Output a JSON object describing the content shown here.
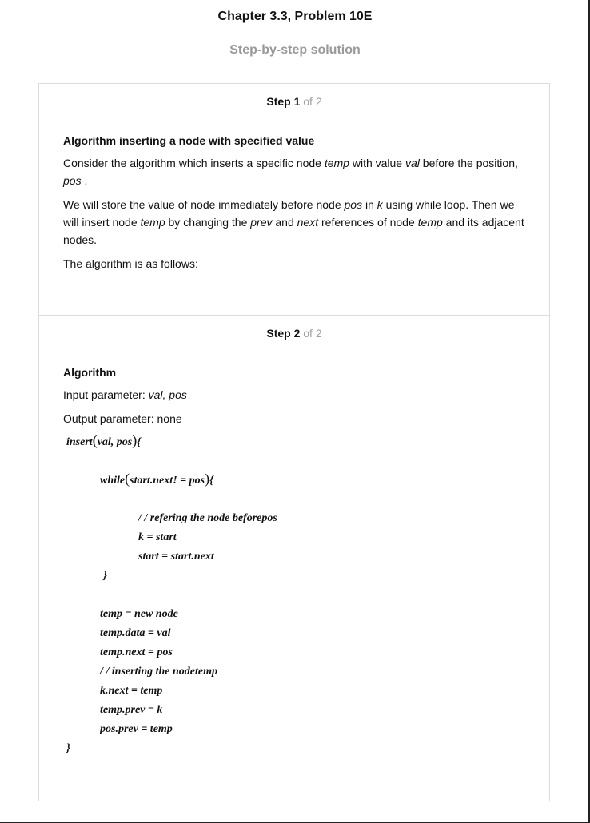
{
  "header": {
    "title": "Chapter 3.3, Problem 10E",
    "subtitle": "Step-by-step solution"
  },
  "step1": {
    "label": "Step 1",
    "of": " of 2",
    "heading": "Algorithm inserting a node with specified value",
    "p1": {
      "a": "Consider the algorithm which inserts a specific node ",
      "temp": "temp",
      "b": " with value ",
      "val": "val",
      "c": " before the position, ",
      "pos": "pos",
      "d": " ."
    },
    "p2": {
      "a": "We will store the value of node immediately before node ",
      "pos": "pos",
      "b": " in ",
      "k": "k",
      "c": " using while loop. Then we will insert node ",
      "temp": "temp",
      "d": " by changing the ",
      "prev": "prev",
      "e": " and ",
      "next": "next",
      "f": " references of node ",
      "temp2": "temp",
      "g": " and its adjacent nodes."
    },
    "p3": "The algorithm is as follows:"
  },
  "step2": {
    "label": "Step 2",
    "of": " of 2",
    "heading": "Algorithm",
    "input_label": "Input parameter: ",
    "input_value": "val, pos",
    "output": "Output parameter: none",
    "code": {
      "l1_a": "insert",
      "l1_b": "val, pos",
      "l1_c": "{",
      "l2_a": "while",
      "l2_b": "start.next! = pos",
      "l2_c": "{",
      "l3": "/ / refering the node beforepos",
      "l4": "k = start",
      "l5": "start = start.next",
      "l6": "}",
      "l7": "temp = new node",
      "l8": "temp.data = val",
      "l9": "temp.next = pos",
      "l10": "/ / inserting the nodetemp",
      "l11": "k.next = temp",
      "l12": "temp.prev = k",
      "l13": "pos.prev = temp",
      "l14": "}"
    }
  }
}
